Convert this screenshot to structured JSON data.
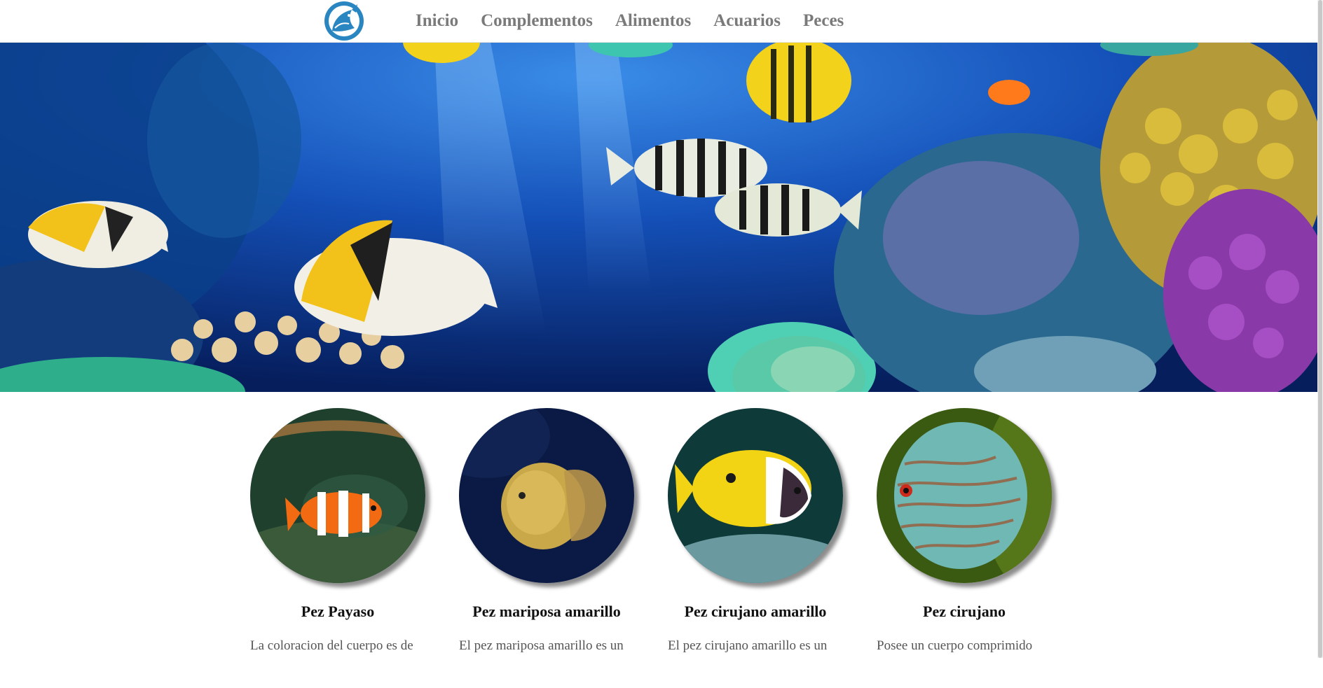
{
  "nav": {
    "logo": "fish-logo-icon",
    "links": [
      "Inicio",
      "Complementos",
      "Alimentos",
      "Acuarios",
      "Peces"
    ]
  },
  "hero": {
    "image": "coral-reef-fish-banner"
  },
  "cards": [
    {
      "title": "Pez Payaso",
      "desc": "La coloracion del cuerpo es de",
      "image": "clownfish"
    },
    {
      "title": "Pez mariposa amarillo",
      "desc": "El pez mariposa amarillo es un",
      "image": "yellow-butterflyfish"
    },
    {
      "title": "Pez cirujano amarillo",
      "desc": "El pez cirujano amarillo es un",
      "image": "yellow-surgeonfish"
    },
    {
      "title": "Pez cirujano",
      "desc": "Posee un cuerpo comprimido",
      "image": "discus-surgeonfish"
    }
  ],
  "colors": {
    "nav_text": "#7a7a7a",
    "title": "#111111",
    "body": "#555555",
    "accent": "#2a86c1"
  }
}
